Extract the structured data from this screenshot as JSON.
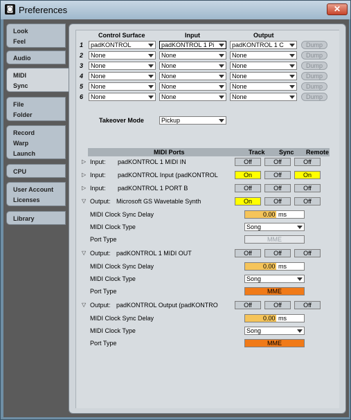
{
  "window": {
    "title": "Preferences",
    "close_label": "✕",
    "app_icon": "ableton-icon"
  },
  "tabs": [
    {
      "lines": [
        "Look",
        "Feel"
      ]
    },
    {
      "lines": [
        "Audio"
      ]
    },
    {
      "lines": [
        "MIDI",
        "Sync"
      ]
    },
    {
      "lines": [
        "File",
        "Folder"
      ]
    },
    {
      "lines": [
        "Record",
        "Warp",
        "Launch"
      ]
    },
    {
      "lines": [
        "CPU"
      ]
    },
    {
      "lines": [
        "User Account",
        "Licenses"
      ]
    },
    {
      "lines": [
        "Library"
      ]
    }
  ],
  "active_tab": "MIDI Sync",
  "control_surfaces": {
    "headers": {
      "surface": "Control Surface",
      "input": "Input",
      "output": "Output"
    },
    "rows": [
      {
        "num": "1",
        "surface": "padKONTROL",
        "input": "padKONTROL 1 Pi",
        "output": "padKONTROL 1 C",
        "dump": "Dump"
      },
      {
        "num": "2",
        "surface": "None",
        "input": "None",
        "output": "None",
        "dump": "Dump"
      },
      {
        "num": "3",
        "surface": "None",
        "input": "None",
        "output": "None",
        "dump": "Dump"
      },
      {
        "num": "4",
        "surface": "None",
        "input": "None",
        "output": "None",
        "dump": "Dump"
      },
      {
        "num": "5",
        "surface": "None",
        "input": "None",
        "output": "None",
        "dump": "Dump"
      },
      {
        "num": "6",
        "surface": "None",
        "input": "None",
        "output": "None",
        "dump": "Dump"
      }
    ]
  },
  "takeover": {
    "label": "Takeover Mode",
    "value": "Pickup"
  },
  "midi_ports": {
    "headers": {
      "ports": "MIDI Ports",
      "track": "Track",
      "sync": "Sync",
      "remote": "Remote"
    },
    "ports": [
      {
        "dir": "Input:",
        "name": "padKONTROL 1 MIDI IN",
        "track": "Off",
        "sync": "Off",
        "remote": "Off"
      },
      {
        "dir": "Input:",
        "name": "padKONTROL Input (padKONTROL",
        "track": "On",
        "sync": "Off",
        "remote": "On"
      },
      {
        "dir": "Input:",
        "name": "padKONTROL 1 PORT B",
        "track": "Off",
        "sync": "Off",
        "remote": "Off"
      },
      {
        "dir": "Output:",
        "name": "Microsoft GS Wavetable Synth",
        "track": "On",
        "sync": "Off",
        "remote": "Off",
        "delay_label": "MIDI Clock Sync Delay",
        "delay_value": "0.00",
        "delay_unit": "ms",
        "clock_label": "MIDI Clock Type",
        "clock_value": "Song",
        "porttype_label": "Port Type",
        "porttype_value": "MME"
      },
      {
        "dir": "Output:",
        "name": "padKONTROL 1 MIDI OUT",
        "track": "Off",
        "sync": "Off",
        "remote": "Off",
        "delay_label": "MIDI Clock Sync Delay",
        "delay_value": "0.00",
        "delay_unit": "ms",
        "clock_label": "MIDI Clock Type",
        "clock_value": "Song",
        "porttype_label": "Port Type",
        "porttype_value": "MME"
      },
      {
        "dir": "Output:",
        "name": "padKONTROL Output (padKONTRO",
        "track": "Off",
        "sync": "Off",
        "remote": "Off",
        "delay_label": "MIDI Clock Sync Delay",
        "delay_value": "0.00",
        "delay_unit": "ms",
        "clock_label": "MIDI Clock Type",
        "clock_value": "Song",
        "porttype_label": "Port Type",
        "porttype_value": "MME"
      }
    ]
  },
  "colors": {
    "on": "#ffff00",
    "port_active": "#f07a18",
    "delay_fill": "#f5c45a"
  }
}
